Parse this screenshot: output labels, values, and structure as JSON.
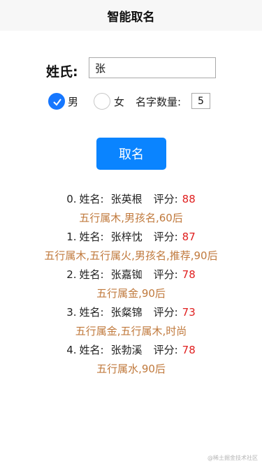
{
  "header": {
    "title": "智能取名"
  },
  "form": {
    "surname_label": "姓氏:",
    "surname_value": "张",
    "gender_options": [
      {
        "label": "男",
        "checked": true
      },
      {
        "label": "女",
        "checked": false
      }
    ],
    "count_label": "名字数量:",
    "count_value": "5",
    "submit_label": "取名"
  },
  "results": [
    {
      "index": "0.",
      "name_label": "姓名:",
      "name": "张英根",
      "score_label": "评分:",
      "score": "88",
      "tags": "五行属木,男孩名,60后"
    },
    {
      "index": "1.",
      "name_label": "姓名:",
      "name": "张梓忱",
      "score_label": "评分:",
      "score": "87",
      "tags": "五行属木,五行属火,男孩名,推荐,90后"
    },
    {
      "index": "2.",
      "name_label": "姓名:",
      "name": "张嘉铷",
      "score_label": "评分:",
      "score": "78",
      "tags": "五行属金,90后"
    },
    {
      "index": "3.",
      "name_label": "姓名:",
      "name": "张粲锦",
      "score_label": "评分:",
      "score": "73",
      "tags": "五行属金,五行属木,时尚"
    },
    {
      "index": "4.",
      "name_label": "姓名:",
      "name": "张勃溪",
      "score_label": "评分:",
      "score": "78",
      "tags": "五行属水,90后"
    }
  ],
  "watermark": "@稀土掘金技术社区",
  "colors": {
    "accent": "#1677ff",
    "button": "#0a84ff",
    "score": "#e02020",
    "tags": "#c0793c"
  }
}
